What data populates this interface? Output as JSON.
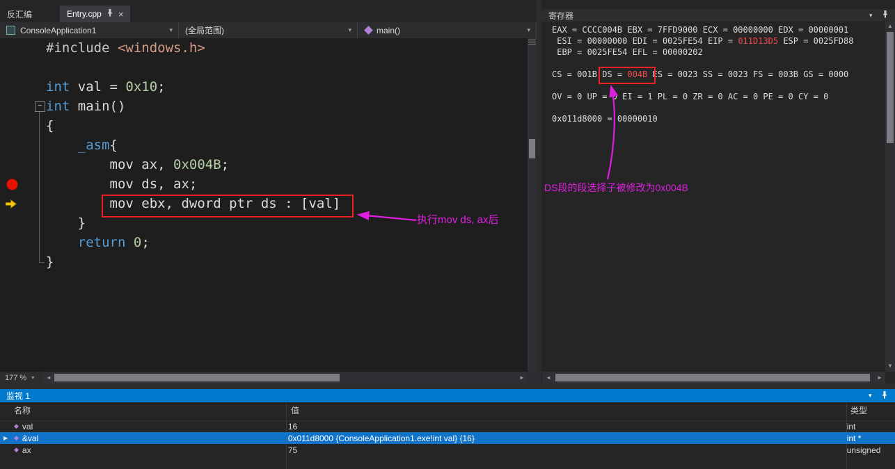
{
  "tabs": {
    "disassembly": "反汇编",
    "entry": "Entry.cpp"
  },
  "navbar": {
    "project": "ConsoleApplication1",
    "scope": "(全局范围)",
    "function": "main()"
  },
  "editor": {
    "zoom_level": "177 %",
    "code_lines": [
      {
        "segments": [
          [
            "#include ",
            "pp"
          ],
          [
            "<windows.h>",
            "str"
          ]
        ]
      },
      {
        "segments": []
      },
      {
        "segments": [
          [
            "int",
            "kw"
          ],
          [
            " val = ",
            "plain"
          ],
          [
            "0x10",
            "num"
          ],
          [
            ";",
            "plain"
          ]
        ]
      },
      {
        "segments": [
          [
            "int",
            "kw"
          ],
          [
            " main()",
            "plain"
          ]
        ],
        "fold": true
      },
      {
        "segments": [
          [
            "{",
            "plain"
          ]
        ]
      },
      {
        "segments": [
          [
            "    ",
            "plain"
          ],
          [
            "_asm",
            "kw"
          ],
          [
            "{",
            "plain"
          ]
        ]
      },
      {
        "segments": [
          [
            "        mov ax, ",
            "plain"
          ],
          [
            "0x004B",
            "num"
          ],
          [
            ";",
            "plain"
          ]
        ]
      },
      {
        "segments": [
          [
            "        mov ds, ax;",
            "plain"
          ]
        ],
        "breakpoint": true
      },
      {
        "segments": [
          [
            "        mov ebx, dword ptr ds : [val]",
            "plain"
          ]
        ],
        "current": true
      },
      {
        "segments": [
          [
            "    }",
            "plain"
          ]
        ]
      },
      {
        "segments": [
          [
            "    ",
            "plain"
          ],
          [
            "return",
            "kw"
          ],
          [
            " ",
            "plain"
          ],
          [
            "0",
            "num"
          ],
          [
            ";",
            "plain"
          ]
        ]
      },
      {
        "segments": [
          [
            "}",
            "plain"
          ]
        ]
      }
    ]
  },
  "registers": {
    "title": "寄存器",
    "lines": [
      {
        "segments": [
          [
            "EAX = CCCC004B EBX = 7FFD9000 ECX = 00000000 EDX = 00000001",
            "plain"
          ]
        ]
      },
      {
        "segments": [
          [
            " ESI = 00000000 EDI = 0025FE54 EIP = ",
            "plain"
          ],
          [
            "011D13D5",
            "changed"
          ],
          [
            " ESP = 0025FD88",
            "plain"
          ]
        ]
      },
      {
        "segments": [
          [
            " EBP = 0025FE54 EFL = 00000202",
            "plain"
          ]
        ]
      },
      {
        "segments": []
      },
      {
        "segments": [
          [
            "CS = 001B DS = ",
            "plain"
          ],
          [
            "004B",
            "changed"
          ],
          [
            " ES = 0023 SS = 0023 FS = 003B GS = 0000",
            "plain"
          ]
        ]
      },
      {
        "segments": []
      },
      {
        "segments": [
          [
            "OV = 0 UP = 0 EI = 1 PL = 0 ZR = 0 AC = 0 PE = 0 CY = 0",
            "plain"
          ]
        ]
      },
      {
        "segments": []
      },
      {
        "segments": [
          [
            "0x011d8000 = 00000010",
            "plain"
          ]
        ]
      }
    ]
  },
  "annotations": {
    "code_note": "执行mov ds, ax后",
    "ds_note": "DS段的段选择子被修改为0x004B"
  },
  "watch": {
    "title": "监视 1",
    "columns": [
      "名称",
      "值",
      "类型"
    ],
    "rows": [
      {
        "name": "val",
        "value": "16",
        "type": "int",
        "selected": false,
        "expandable": false
      },
      {
        "name": "&val",
        "value": "0x011d8000 {ConsoleApplication1.exe!int val} {16}",
        "type": "int *",
        "selected": true,
        "expandable": true
      },
      {
        "name": "ax",
        "value": "75",
        "type": "unsigned",
        "selected": false,
        "expandable": false
      }
    ]
  },
  "icons": {
    "close": "×",
    "caret_down": "▾",
    "collapse_minus": "−",
    "scroll_left": "◄",
    "scroll_right": "►",
    "scroll_up": "▲",
    "scroll_down": "▼",
    "expander_collapsed": "▶",
    "variable_diamond": "◆"
  },
  "colors": {
    "accent": "#007acc",
    "annotation_red": "#ed2121",
    "annotation_magenta": "#e01ee0",
    "selection_blue": "#1073c9",
    "changed_register_red": "#f14c4c"
  }
}
